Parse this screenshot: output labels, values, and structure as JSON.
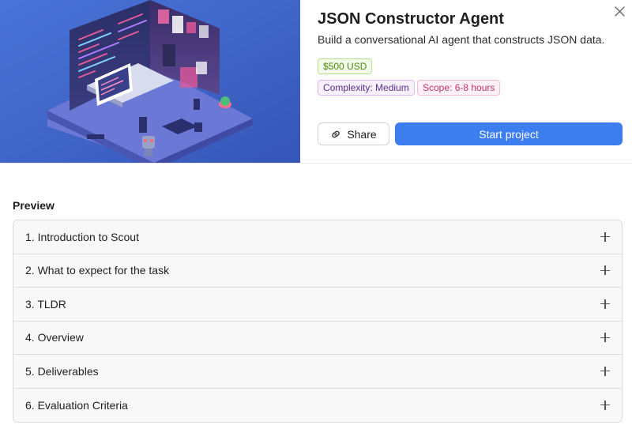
{
  "project": {
    "title": "JSON Constructor Agent",
    "subtitle": "Build a conversational AI agent that constructs JSON data.",
    "price": "$500 USD",
    "complexity": "Complexity: Medium",
    "scope": "Scope: 6-8 hours"
  },
  "actions": {
    "share_label": "Share",
    "start_label": "Start project"
  },
  "preview": {
    "heading": "Preview",
    "items": [
      {
        "label": "1. Introduction to Scout"
      },
      {
        "label": "2. What to expect for the task"
      },
      {
        "label": "3. TLDR"
      },
      {
        "label": "4. Overview"
      },
      {
        "label": "5. Deliverables"
      },
      {
        "label": "6. Evaluation Criteria"
      }
    ]
  },
  "icons": {
    "close": "close-icon",
    "share": "link-icon",
    "expand": "plus-icon"
  },
  "colors": {
    "primary": "#3c7df0",
    "price_badge": "#4d8a18",
    "complexity_badge": "#5a2e8c",
    "scope_badge": "#c2306f",
    "hero_background": "#3f63c9"
  }
}
